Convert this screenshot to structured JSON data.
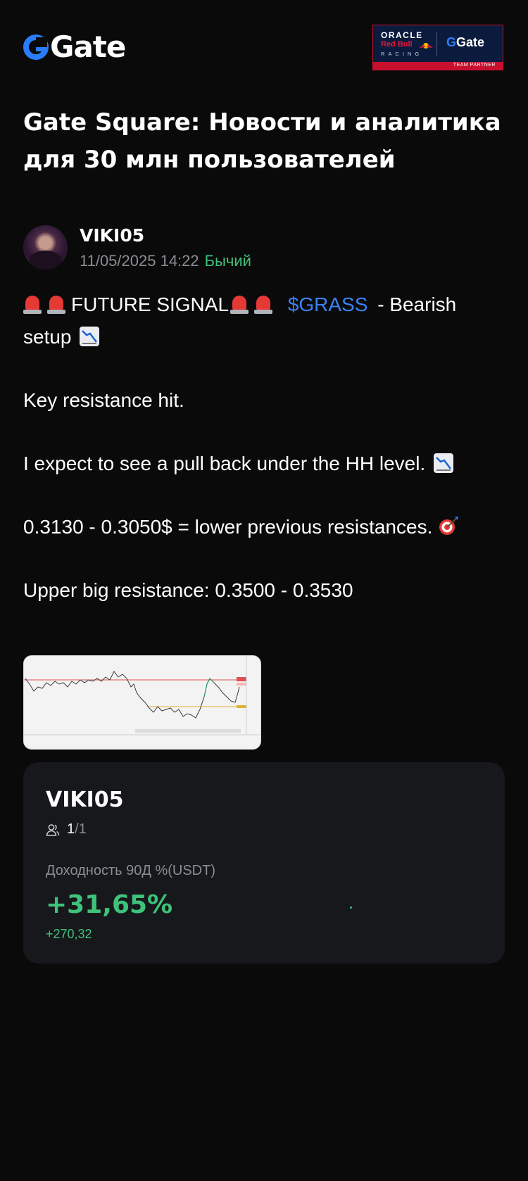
{
  "header": {
    "brand": "Gate",
    "partner": {
      "oracle": "ORACLE",
      "redbull": "Red Bull",
      "racing": "RACING",
      "gate": "Gate",
      "tag": "TEAM PARTNER"
    }
  },
  "page_title": "Gate Square: Новости и аналитика для 30 млн пользователей",
  "author": {
    "name": "VIKI05",
    "timestamp": "11/05/2025 14:22",
    "sentiment": "Бычий"
  },
  "post": {
    "signal_label": "FUTURE SIGNAL",
    "ticker": "$GRASS",
    "setup": " - Bearish setup",
    "line_resistance": "Key resistance hit.",
    "line_pullback": "I expect to see a pull back under the HH level.",
    "line_targets": "0.3130 - 0.3050$ = lower previous resistances.",
    "line_upper": "Upper big resistance:  0.3500 - 0.3530"
  },
  "card": {
    "name": "VIKI05",
    "followers_current": "1",
    "followers_total": "/1",
    "roi_label": "Доходность 90Д %(USDT)",
    "roi_value": "+31,65%",
    "pnl_value": "+270,32"
  },
  "colors": {
    "accent_blue": "#3b82f6",
    "positive_green": "#3ec37a",
    "background": "#0a0a0a",
    "card_bg": "#17181b"
  },
  "icons": [
    "gate-logo-icon",
    "siren-icon",
    "chart-decreasing-icon",
    "target-icon",
    "users-icon"
  ]
}
